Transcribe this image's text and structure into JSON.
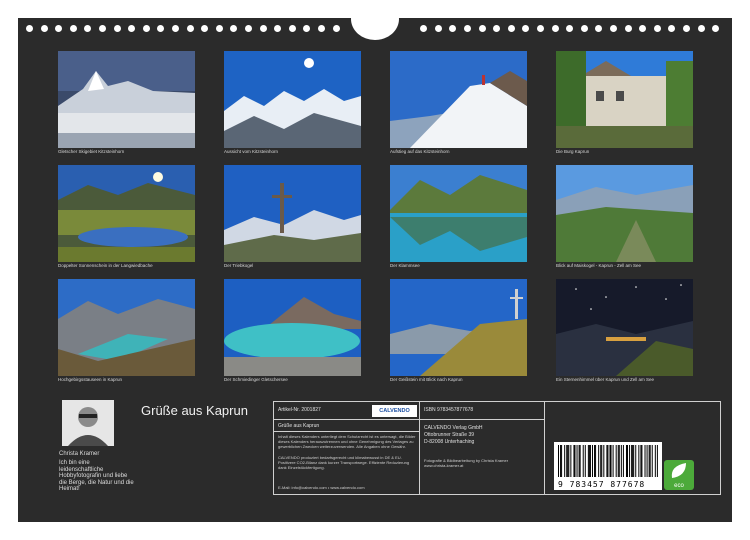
{
  "captions": [
    "Gletscher Skigebiet Kitzsteinhorn",
    "Aussicht vom Kitzsteinhorn",
    "Aufstieg auf das Kitzsteinhorn",
    "Die Burg Kaprun",
    "Doppelter Sonnenschein in der Langwiedbache",
    "Der Triebkogel",
    "Der Klammsee",
    "Blick auf Maiskogel - Kaprun - Zell am See",
    "Hochgebirgsstauseen in Kaprun",
    "Der Schmiedinger Gletschersee",
    "Der Geißstein mit Blick nach Kaprun",
    "Ein Sternenhimmel über Kaprun und Zell am See"
  ],
  "title": "Grüße aus Kaprun",
  "artist": {
    "name": "Christa Kramer",
    "bio": "Ich bin eine leidenschaftliche Hobbyfotografin und liebe die Berge, die Natur und die Heimat!"
  },
  "info": {
    "article": "Artikel-Nr. 2001827",
    "calvendo_logo": "CALVENDO",
    "product_title": "Grüße aus Kaprun",
    "copyright_text": "Inhalt dieses Kalenders unterliegt dem Schutzrecht ist es untersagt, die Bilder dieses Kalenders herauszutrennen und ohne Genehmigung des Verlages zu gewerblichen Zwecken weiterzuverwenden. Alle Angaben ohne Gewähr.",
    "production_text": "CALVENDO produziert bedarfsgerecht und klimabewusst in DE & EU. Positivere CO2-Bilanz dank kurzer Transportwege. Effiziente Reduzierung dank Einzelstückfertigung.",
    "contact": "E-Mail: info@calvendo.com • www.calvendo.com",
    "isbn": "ISBN 9783457877678",
    "publisher": [
      "CALVENDO Verlag GmbH",
      "Ottobrunner Straße 39",
      "D-82008 Unterhaching"
    ],
    "photo_credit": [
      "Fotografie & Bildbearbeitung by Christa Kramer",
      "www.christa-kramer.at"
    ],
    "barcode_digits": "9 783457 877678",
    "eco_label": "eco"
  }
}
